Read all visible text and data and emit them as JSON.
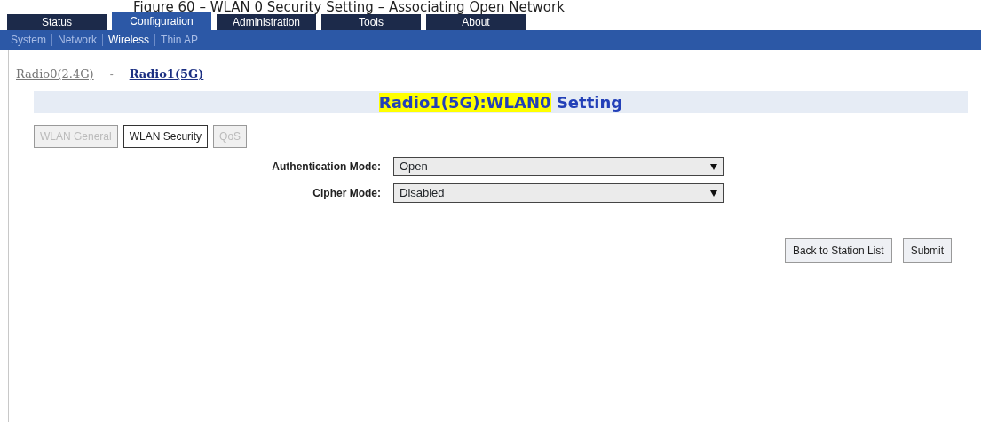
{
  "caption": "Figure 60 – WLAN 0 Security Setting – Associating Open Network",
  "main_tabs": [
    {
      "label": "Status",
      "selected": false
    },
    {
      "label": "Configuration",
      "selected": true
    },
    {
      "label": "Administration",
      "selected": false
    },
    {
      "label": "Tools",
      "selected": false
    },
    {
      "label": "About",
      "selected": false
    }
  ],
  "sub_tabs": [
    {
      "label": "System",
      "selected": false
    },
    {
      "label": "Network",
      "selected": false
    },
    {
      "label": "Wireless",
      "selected": true
    },
    {
      "label": "Thin AP",
      "selected": false
    }
  ],
  "radio_links": [
    {
      "label": "Radio0(2.4G)",
      "selected": false
    },
    {
      "label": "Radio1(5G)",
      "selected": true
    }
  ],
  "radio_separator": "-",
  "heading": {
    "highlight": "Radio1(5G):WLAN0",
    "rest": "Setting"
  },
  "section_tabs": [
    {
      "label": "WLAN General",
      "selected": false,
      "disabled": true
    },
    {
      "label": "WLAN Security",
      "selected": true,
      "disabled": false
    },
    {
      "label": "QoS",
      "selected": false,
      "disabled": true
    }
  ],
  "fields": [
    {
      "label": "Authentication Mode:",
      "value": "Open"
    },
    {
      "label": "Cipher Mode:",
      "value": "Disabled"
    }
  ],
  "buttons": [
    "Back to Station List",
    "Submit"
  ]
}
